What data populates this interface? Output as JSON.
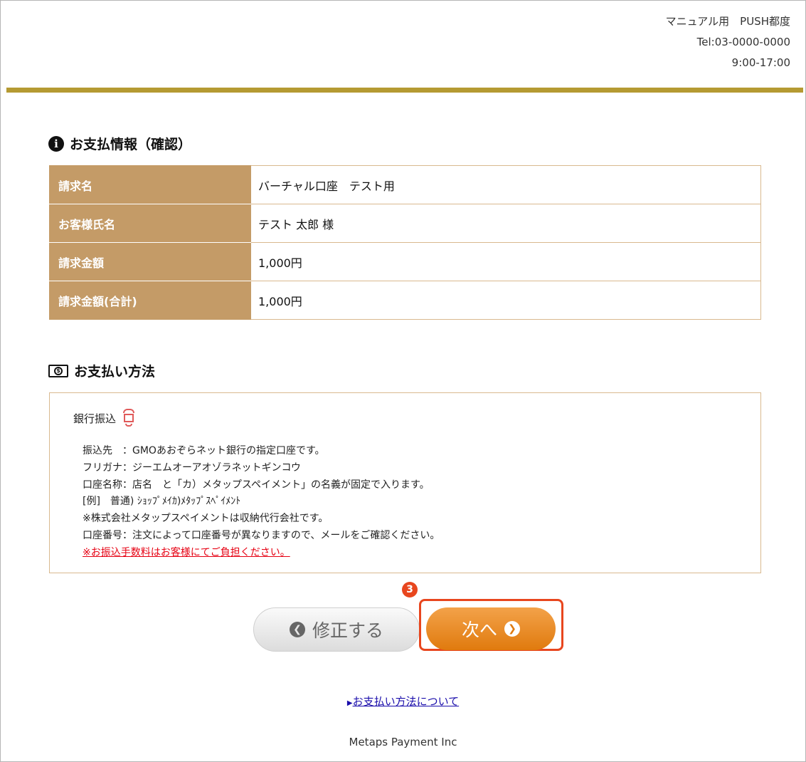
{
  "header": {
    "shop_name": "マニュアル用　PUSH都度",
    "tel": "Tel:03-0000-0000",
    "hours": "9:00-17:00"
  },
  "confirm_section": {
    "icon": "info-icon",
    "title": "お支払情報（確認）",
    "rows": [
      {
        "label": "請求名",
        "value": "バーチャル口座　テスト用"
      },
      {
        "label": "お客様氏名",
        "value": "テスト 太郎 様"
      },
      {
        "label": "請求金額",
        "value": "1,000円"
      },
      {
        "label": "請求金額(合計)",
        "value": "1,000円"
      }
    ]
  },
  "method_section": {
    "icon": "money-icon",
    "title": "お支払い方法",
    "method_name": "銀行振込",
    "method_icon": "bank-icon",
    "details": [
      "振込先　：GMOあおぞらネット銀行の指定口座です。",
      "フリガナ：ジーエムオーアオゾラネットギンコウ",
      "口座名称：店名　と「カ）メタップスペイメント」の名義が固定で入ります。",
      "[例]　普通) ｼｮｯﾌﾟﾒｲｶ)ﾒﾀｯﾌﾟｽﾍﾟｲﾒﾝﾄ",
      "※株式会社メタップスペイメントは収納代行会社です。",
      "口座番号：注文によって口座番号が異なりますので、メールをご確認ください。"
    ],
    "warning": "※お振込手数料はお客様にてご負担ください。"
  },
  "buttons": {
    "back_label": "修正する",
    "back_icon": "arrow-left-circle-icon",
    "next_label": "次へ",
    "next_icon": "arrow-right-circle-icon",
    "step_badge": "3"
  },
  "links": {
    "about_payment": "お支払い方法について"
  },
  "footer": {
    "company": "Metaps Payment Inc"
  },
  "colors": {
    "gold_bar": "#b59a32",
    "table_label_bg": "#c49b67",
    "next_button": "#e07a0e",
    "highlight": "#e8461e",
    "warning_text": "#e60012"
  }
}
